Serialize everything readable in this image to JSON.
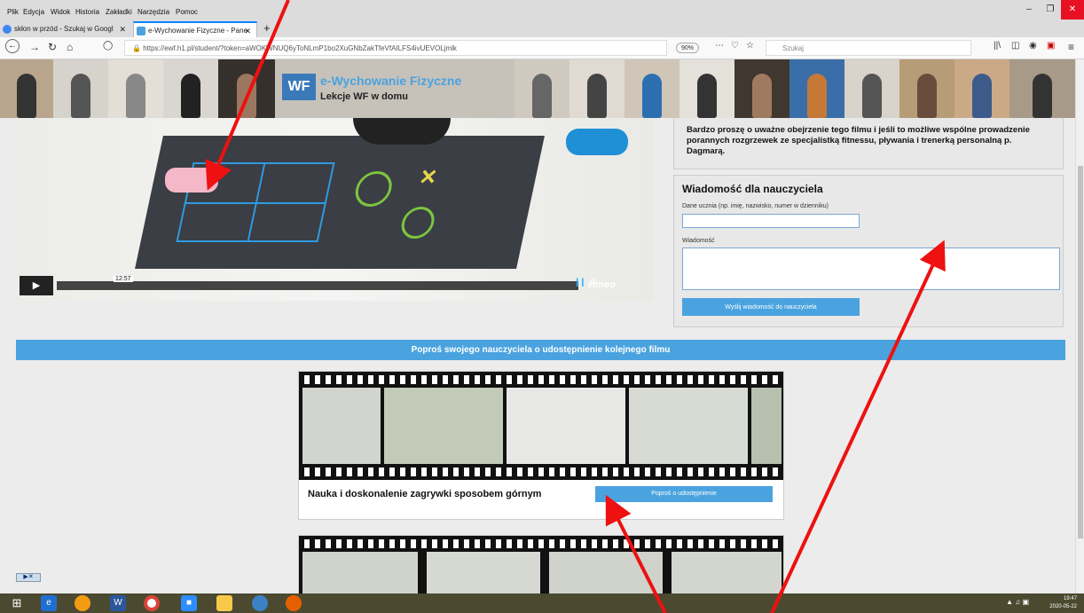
{
  "menubar": {
    "items": [
      "Plik",
      "Edycja",
      "Widok",
      "Historia",
      "Zakładki",
      "Narzędzia",
      "Pomoc"
    ]
  },
  "tabs": [
    {
      "label": "skłon w przód - Szukaj w Googl",
      "icon": "google-icon"
    },
    {
      "label": "e-Wychowanie Fizyczne - Pane",
      "icon": "ewf-icon",
      "active": true
    }
  ],
  "nav": {
    "url": "https://ewf.h1.pl/student/?token=aWOKWNUQ6yToNLmP1bo2XuGNbZakTfeVfAILFS4ivUEVOLjmlk",
    "url_domain": "h1.pl",
    "zoom": "90%",
    "search_placeholder": "Szukaj"
  },
  "logo": {
    "mark": "WF",
    "title": "e-Wychowanie Fizyczne",
    "subtitle": "Lekcje WF w domu"
  },
  "video": {
    "timecode": "12:57",
    "provider": "vimeo"
  },
  "description": "Bardzo proszę o uważne obejrzenie tego filmu i jeśli to możliwe wspólne prowadzenie porannych rozgrzewek ze specjalistką fitnessu, pływania i trenerką personalną p. Dagmarą.",
  "message_form": {
    "title": "Wiadomość dla nauczyciela",
    "name_label": "Dane ucznia (np. imię, nazwisko, numer w dzienniku)",
    "name_value": "",
    "message_label": "Wiadomość",
    "message_value": "",
    "send_label": "Wyślij wiadomość do nauczyciela"
  },
  "request_bar": "Poproś swojego nauczyciela o udostępnienie kolejnego filmu",
  "cards": [
    {
      "title": "Nauka i doskonalenie zagrywki sposobem górnym",
      "button": "Poproś o udostępnienie"
    },
    {
      "title": "",
      "button": ""
    }
  ],
  "taskbar": {
    "time": "19:47",
    "date": "2020-05-22"
  },
  "colors": {
    "accent": "#4aa3df",
    "arrow": "#ee1111",
    "close": "#e81123"
  }
}
